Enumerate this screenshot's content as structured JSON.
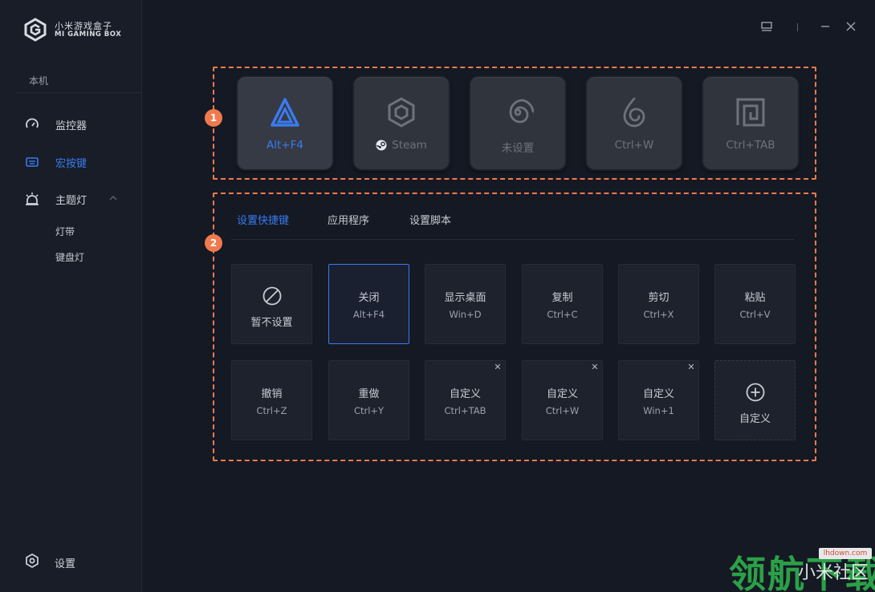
{
  "app": {
    "name_cn": "小米游戏盒子",
    "name_en": "MI GAMING BOX"
  },
  "sidebar": {
    "device_label": "本机",
    "items": [
      {
        "label": "监控器",
        "icon": "gauge-icon"
      },
      {
        "label": "宏按键",
        "icon": "keyboard-icon",
        "active": true
      },
      {
        "label": "主题灯",
        "icon": "lamp-icon",
        "expanded": true
      }
    ],
    "sub_items": [
      {
        "label": "灯带"
      },
      {
        "label": "键盘灯"
      }
    ],
    "settings_label": "设置"
  },
  "annotations": {
    "one": "1",
    "two": "2"
  },
  "macro_slots": [
    {
      "label": "Alt+F4",
      "icon": "triangle-logo-icon",
      "active": true
    },
    {
      "label": "Steam",
      "icon": "hexagon-icon",
      "badge_icon": "steam-icon"
    },
    {
      "label": "未设置",
      "icon": "spiral-icon"
    },
    {
      "label": "Ctrl+W",
      "icon": "swirl-drop-icon"
    },
    {
      "label": "Ctrl+TAB",
      "icon": "square-spiral-icon"
    }
  ],
  "tabs": [
    {
      "label": "设置快捷键",
      "active": true
    },
    {
      "label": "应用程序"
    },
    {
      "label": "设置脚本"
    }
  ],
  "shortcuts": {
    "none": {
      "label": "暂不设置"
    },
    "row1": [
      {
        "title": "关闭",
        "key": "Alt+F4",
        "selected": true
      },
      {
        "title": "显示桌面",
        "key": "Win+D"
      },
      {
        "title": "复制",
        "key": "Ctrl+C"
      },
      {
        "title": "剪切",
        "key": "Ctrl+X"
      },
      {
        "title": "粘贴",
        "key": "Ctrl+V"
      }
    ],
    "row2": [
      {
        "title": "撤销",
        "key": "Ctrl+Z"
      },
      {
        "title": "重做",
        "key": "Ctrl+Y"
      },
      {
        "title": "自定义",
        "key": "Ctrl+TAB",
        "removable": true
      },
      {
        "title": "自定义",
        "key": "Ctrl+W",
        "removable": true
      },
      {
        "title": "自定义",
        "key": "Win+1",
        "removable": true
      }
    ],
    "add": {
      "label": "自定义"
    },
    "close_glyph": "✕"
  },
  "colors": {
    "accent": "#3a7bf0",
    "annotation": "#f07a4e",
    "background": "#141923",
    "sidebar": "#181d27"
  },
  "watermark": {
    "site": "lhdown.com",
    "big": "领航下载",
    "small": "小米社区"
  }
}
